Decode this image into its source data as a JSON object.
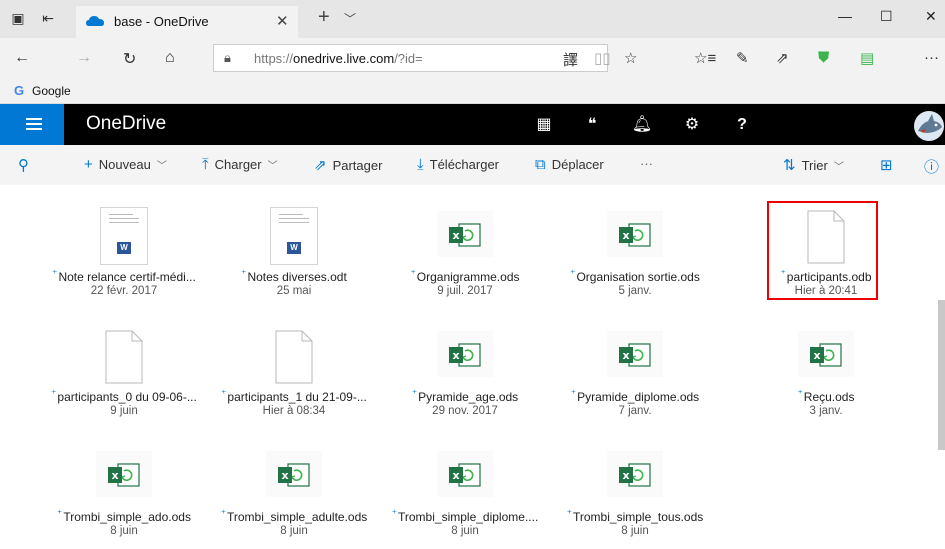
{
  "browser": {
    "tab_title": "base - OneDrive",
    "url_prefix": "https://",
    "url_domain": "onedrive.live.com",
    "url_suffix": "/?id=",
    "favorites": [
      {
        "label": "Google"
      }
    ]
  },
  "onedrive": {
    "app_title": "OneDrive",
    "toolbar": {
      "new_label": "Nouveau",
      "upload_label": "Charger",
      "share_label": "Partager",
      "download_label": "Télécharger",
      "move_label": "Déplacer",
      "more_label": "···",
      "sort_label": "Trier"
    },
    "files": [
      {
        "name": "Note relance certif-médi...",
        "date": "22 févr. 2017",
        "type": "word-doc",
        "selected": false
      },
      {
        "name": "Notes diverses.odt",
        "date": "25 mai",
        "type": "word-doc",
        "selected": false
      },
      {
        "name": "Organigramme.ods",
        "date": "9 juil. 2017",
        "type": "spreadsheet",
        "selected": false
      },
      {
        "name": "Organisation sortie.ods",
        "date": "5 janv.",
        "type": "spreadsheet",
        "selected": false
      },
      {
        "name": "participants.odb",
        "date": "Hier à 20:41",
        "type": "blank",
        "selected": true
      },
      {
        "name": "participants_0 du 09-06-...",
        "date": "9 juin",
        "type": "blank",
        "selected": false
      },
      {
        "name": "participants_1 du 21-09-...",
        "date": "Hier à 08:34",
        "type": "blank",
        "selected": false
      },
      {
        "name": "Pyramide_age.ods",
        "date": "29 nov. 2017",
        "type": "spreadsheet",
        "selected": false
      },
      {
        "name": "Pyramide_diplome.ods",
        "date": "7 janv.",
        "type": "spreadsheet",
        "selected": false
      },
      {
        "name": "Reçu.ods",
        "date": "3 janv.",
        "type": "spreadsheet",
        "selected": false
      },
      {
        "name": "Trombi_simple_ado.ods",
        "date": "8 juin",
        "type": "spreadsheet",
        "selected": false
      },
      {
        "name": "Trombi_simple_adulte.ods",
        "date": "8 juin",
        "type": "spreadsheet",
        "selected": false
      },
      {
        "name": "Trombi_simple_diplome....",
        "date": "8 juin",
        "type": "spreadsheet",
        "selected": false
      },
      {
        "name": "Trombi_simple_tous.ods",
        "date": "8 juin",
        "type": "spreadsheet",
        "selected": false
      }
    ]
  },
  "colors": {
    "accent": "#0078d4",
    "header_bg": "#000000",
    "excel_green": "#217346",
    "selection_border": "#e00000"
  }
}
